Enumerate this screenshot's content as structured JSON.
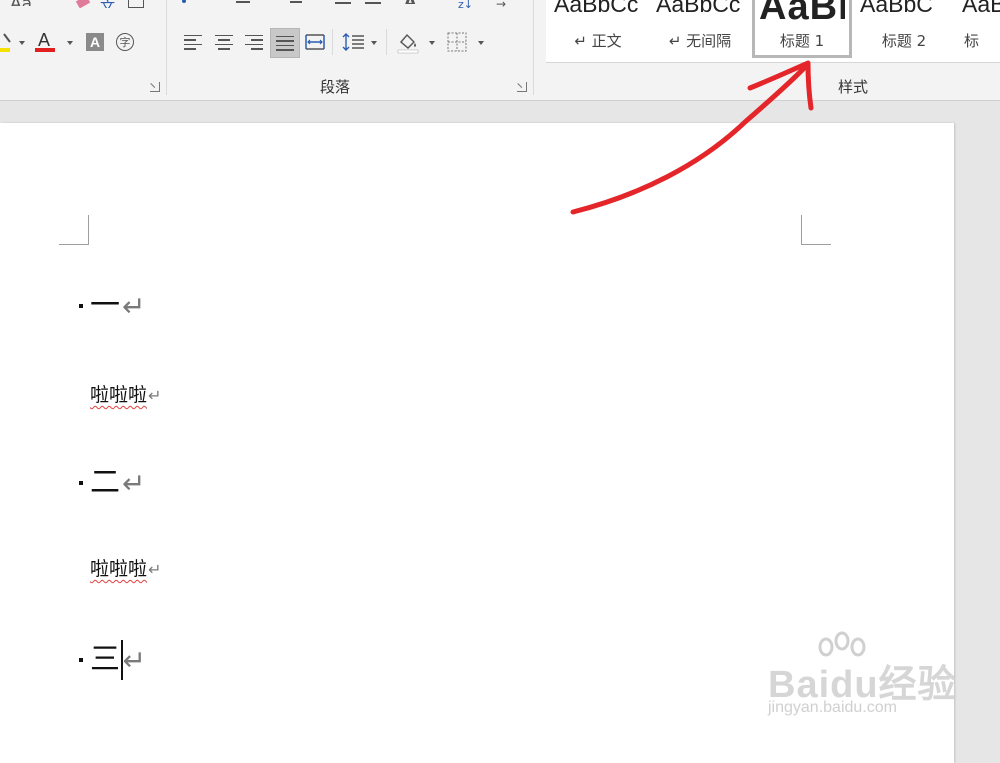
{
  "ribbon": {
    "paragraph_group_label": "段落",
    "styles_group_label": "样式",
    "font_partial_label": "Aa"
  },
  "styles": [
    {
      "preview": "AaBbCc",
      "name": "↵ 正文",
      "selected": false
    },
    {
      "preview": "AaBbCc",
      "name": "↵ 无间隔",
      "selected": false
    },
    {
      "preview": "AaBl",
      "name": "标题 1",
      "selected": true
    },
    {
      "preview": "AaBbC",
      "name": "标题 2",
      "selected": false
    },
    {
      "preview": "AaB",
      "name": "标",
      "selected": false
    }
  ],
  "document": {
    "paragraphs": [
      {
        "type": "heading",
        "text": "一"
      },
      {
        "type": "body",
        "text": "啦啦啦"
      },
      {
        "type": "heading",
        "text": "二"
      },
      {
        "type": "body",
        "text": "啦啦啦"
      },
      {
        "type": "heading",
        "text": "三"
      }
    ],
    "pilcrow": "↵"
  },
  "watermark": {
    "brand": "Baidu经验",
    "sub": "jingyan.baidu.com"
  },
  "colors": {
    "accent_red": "#e4262a",
    "font_color_underline": "#e02020",
    "highlight_yellow": "#f4e100",
    "ribbon_bg": "#f3f3f3",
    "canvas_bg": "#e6e6e6"
  },
  "icons": {
    "font_color": "font-color-icon",
    "shading": "paint-bucket-icon",
    "borders": "borders-icon",
    "line_spacing": "line-spacing-icon",
    "distributed": "distributed-align-icon",
    "enclosed": "enclosed-character-icon"
  }
}
